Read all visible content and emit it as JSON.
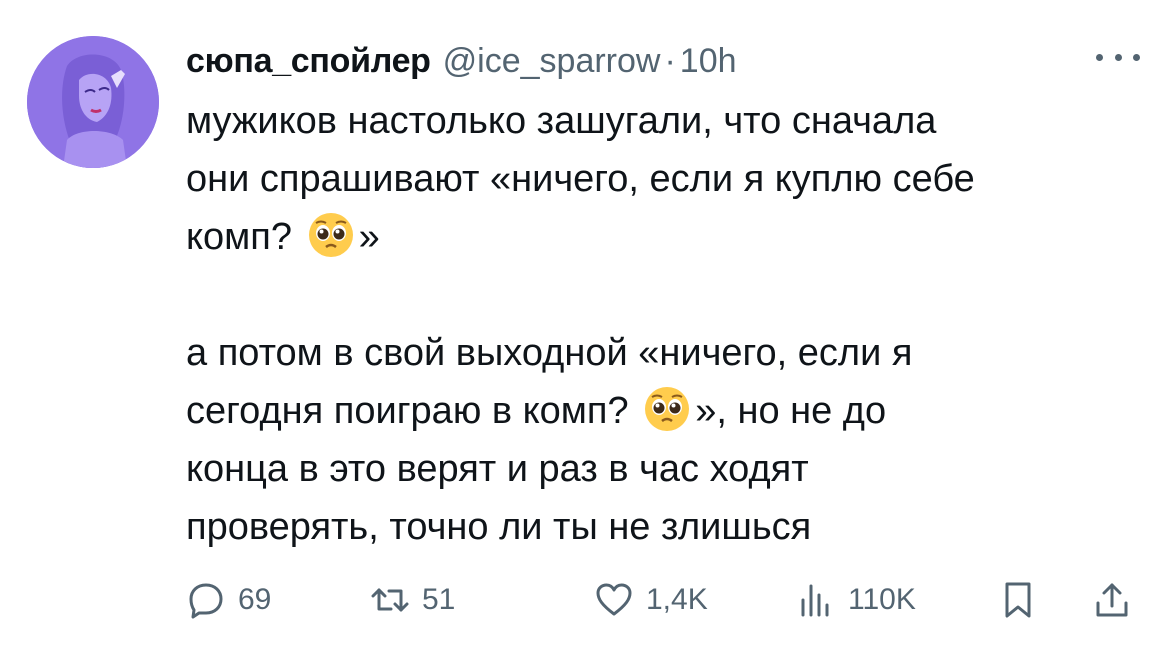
{
  "author": {
    "display_name": "сюпа_спойлер",
    "handle": "@ice_sparrow",
    "separator": "·",
    "time": "10h"
  },
  "tweet": {
    "lines_part1": [
      "мужиков настолько зашугали, что сначала",
      "они спрашивают «ничего, если я куплю себе"
    ],
    "line3_before": "комп?",
    "line3_after": "»",
    "line4": "а потом в свой выходной «ничего, если я",
    "line5_before": "сегодня поиграю в комп?",
    "line5_after": "», но не до",
    "lines_part3": [
      "конца в это верят и раз в час ходят",
      "проверять, точно ли ты не злишься"
    ],
    "emoji_icon": "pleading-face-emoji"
  },
  "actions": {
    "reply_count": "69",
    "retweet_count": "51",
    "like_count": "1,4K",
    "views_count": "110K"
  },
  "colors": {
    "text": "#0f1419",
    "secondary": "#536471",
    "avatar_bg": "#8f74e6"
  }
}
